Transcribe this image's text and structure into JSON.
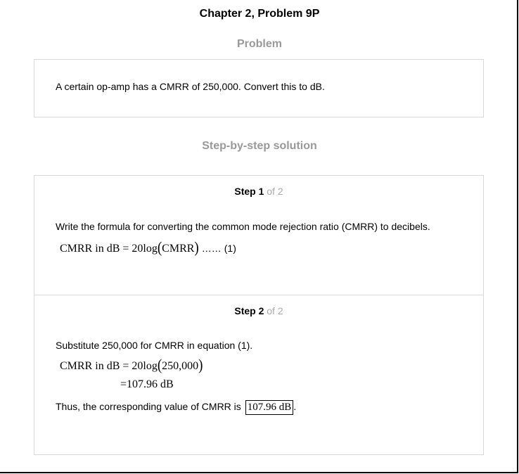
{
  "header": {
    "title": "Chapter 2, Problem 9P"
  },
  "problem": {
    "heading": "Problem",
    "text": "A certain op-amp has a CMRR of 250,000. Convert this to dB."
  },
  "solution": {
    "heading": "Step-by-step solution",
    "steps": [
      {
        "label": "Step 1",
        "of": "of 2",
        "text": "Write the formula for converting the common mode rejection ratio (CMRR) to decibels.",
        "equation": {
          "lhs": "CMRR in dB",
          "eq": "=",
          "coef": "20",
          "fn": "log",
          "arg": "CMRR",
          "tag_dots": "……",
          "tag": "(1)"
        }
      },
      {
        "label": "Step 2",
        "of": "of 2",
        "text": "Substitute 250,000 for CMRR in equation (1).",
        "equation_line1": {
          "lhs": "CMRR in dB",
          "eq": "=",
          "coef": "20",
          "fn": "log",
          "arg": "250,000"
        },
        "equation_line2": {
          "eq": "=",
          "value": "107.96 dB"
        },
        "conclusion": "Thus, the corresponding value of CMRR is",
        "answer": "107.96 dB",
        "end_punct": "."
      }
    ]
  }
}
